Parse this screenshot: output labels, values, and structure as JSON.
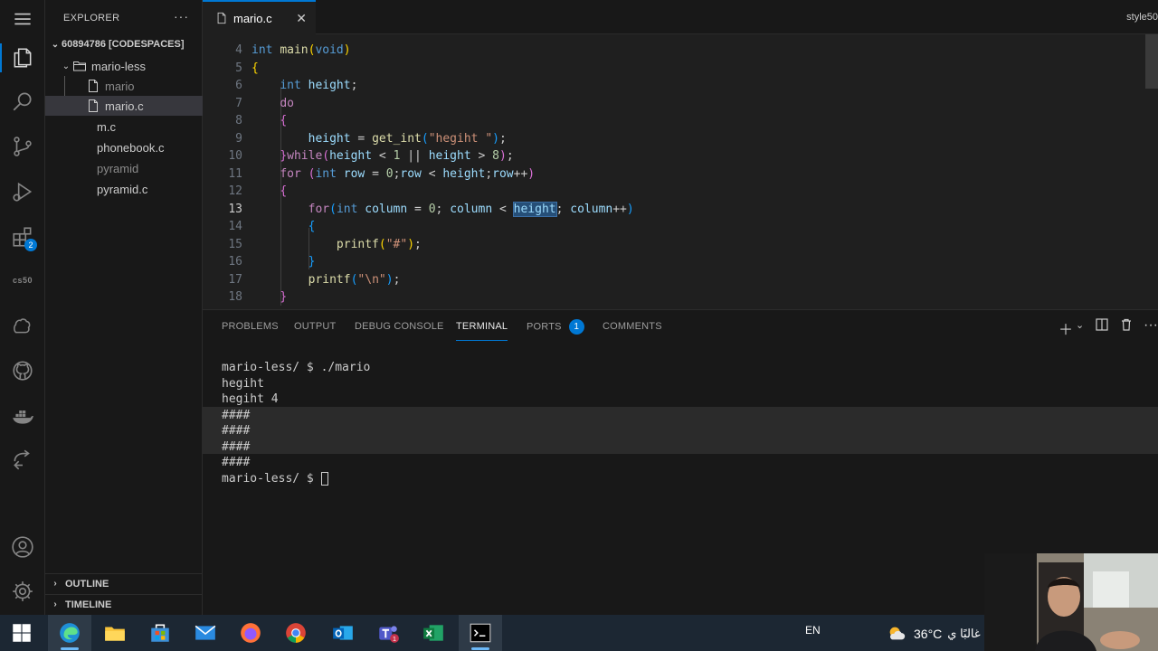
{
  "activity_bar": {
    "items": [
      "explorer-icon",
      "search-icon",
      "source-control-icon",
      "run-debug-icon",
      "extensions-icon",
      "cs50-icon",
      "brain-icon",
      "github-icon",
      "docker-icon",
      "remote-icon"
    ],
    "extensions_badge": "2",
    "cs50_label": "cs50",
    "bottom": [
      "account-icon",
      "settings-icon"
    ]
  },
  "sidebar": {
    "title": "EXPLORER",
    "more": "···",
    "root": "60894786 [CODESPACES]",
    "folder": "mario-less",
    "files": [
      "mario",
      "mario.c"
    ],
    "root_files": [
      "m.c",
      "phonebook.c",
      "pyramid",
      "pyramid.c"
    ],
    "outline": "OUTLINE",
    "timeline": "TIMELINE"
  },
  "tabs": {
    "active": "mario.c",
    "close": "✕",
    "right_label": "style50"
  },
  "editor": {
    "line_numbers": [
      "4",
      "5",
      "6",
      "7",
      "8",
      "9",
      "10",
      "11",
      "12",
      "13",
      "14",
      "15",
      "16",
      "17",
      "18"
    ]
  },
  "panel": {
    "tabs": [
      "PROBLEMS",
      "OUTPUT",
      "DEBUG CONSOLE",
      "TERMINAL",
      "PORTS",
      "COMMENTS"
    ],
    "ports_badge": "1",
    "terminal": [
      "mario-less/ $ ./mario",
      "hegiht",
      "hegiht 4",
      "####",
      "####",
      "####",
      "####"
    ],
    "prompt": "mario-less/ $ "
  },
  "taskbar": {
    "apps": [
      "windows-start-icon",
      "edge-icon",
      "file-explorer-icon",
      "store-icon",
      "mail-icon",
      "firefox-icon",
      "chrome-icon",
      "outlook-icon",
      "teams-icon",
      "excel-icon",
      "vscode-terminal-icon"
    ],
    "teams_badge": "1",
    "lang": "EN",
    "temperature": "36°C",
    "weather_text": "غالبًا ي"
  },
  "colors": {
    "accent": "#0078d4",
    "editor_bg": "#1f1f1f",
    "sidebar_bg": "#181818"
  }
}
